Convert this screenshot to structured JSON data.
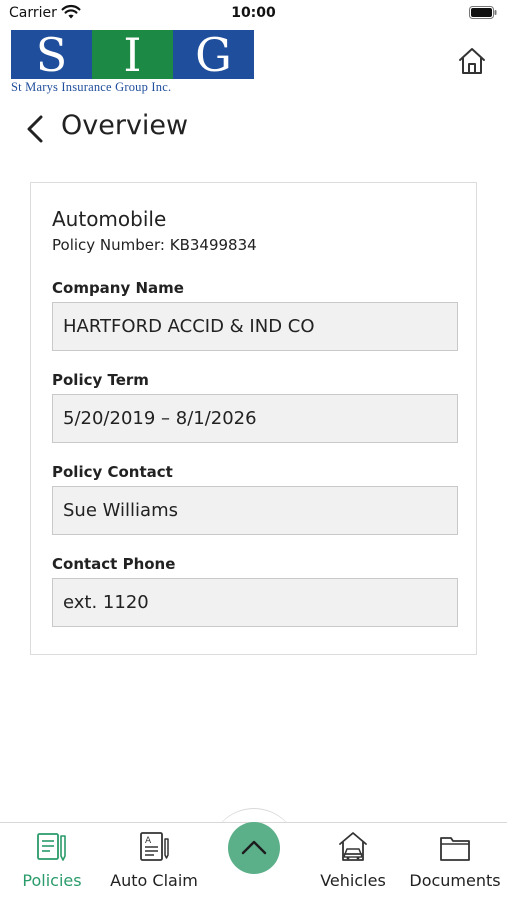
{
  "status_bar": {
    "carrier": "Carrier",
    "time": "10:00"
  },
  "logo": {
    "letters": [
      "S",
      "I",
      "G"
    ],
    "tagline": "St Marys Insurance Group Inc."
  },
  "header": {
    "title": "Overview"
  },
  "policy": {
    "type": "Automobile",
    "number_line": "Policy Number: KB3499834",
    "fields": [
      {
        "label": "Company Name",
        "value": "HARTFORD ACCID & IND CO"
      },
      {
        "label": "Policy Term",
        "value": "5/20/2019 – 8/1/2026"
      },
      {
        "label": "Policy Contact",
        "value": "Sue Williams"
      },
      {
        "label": "Contact Phone",
        "value": "ext. 1120"
      }
    ]
  },
  "tab_bar": {
    "tabs": [
      {
        "label": "Policies",
        "icon": "policies-icon",
        "active": true
      },
      {
        "label": "Auto Claim",
        "icon": "auto-claim-icon",
        "active": false
      },
      {
        "label": "Vehicles",
        "icon": "vehicles-icon",
        "active": false
      },
      {
        "label": "Documents",
        "icon": "documents-icon",
        "active": false
      }
    ],
    "fab_icon": "chevron-up-icon"
  },
  "colors": {
    "logo_blue": "#1f4e9c",
    "logo_green": "#1c8a45",
    "accent": "#2a9b6a",
    "fab": "#5bb08a"
  }
}
